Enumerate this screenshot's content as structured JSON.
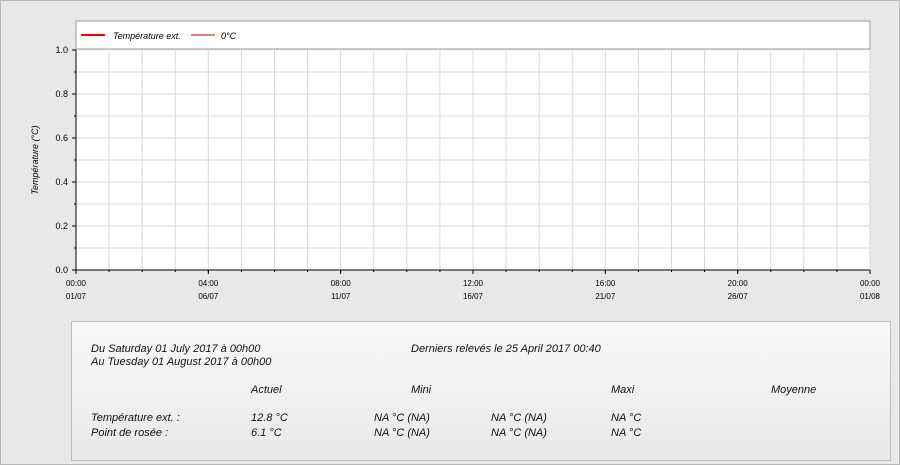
{
  "chart_data": {
    "type": "line",
    "ylabel": "Température (°C)",
    "ylim": [
      0,
      1
    ],
    "yticks": [
      "0.0",
      "0.2",
      "0.4",
      "0.6",
      "0.8",
      "1.0"
    ],
    "x_ticks": [
      {
        "time": "00:00",
        "date": "01/07"
      },
      {
        "time": "04:00",
        "date": "06/07"
      },
      {
        "time": "08:00",
        "date": "11/07"
      },
      {
        "time": "12:00",
        "date": "16/07"
      },
      {
        "time": "16:00",
        "date": "21/07"
      },
      {
        "time": "20:00",
        "date": "26/07"
      },
      {
        "time": "00:00",
        "date": "01/08"
      }
    ],
    "grid": true,
    "legend_position": "top-left",
    "series": [
      {
        "name": "Température ext.",
        "color": "#ff0000",
        "values": []
      },
      {
        "name": "0°C",
        "color": "#cc0000",
        "values": []
      }
    ]
  },
  "info": {
    "period_from": "Du Saturday 01 July 2017 à 00h00",
    "period_to": "Au Tuesday 01 August 2017 à 00h00",
    "last_reading": "Derniers relevés le 25 April 2017 00:40",
    "headers": {
      "actuel": "Actuel",
      "mini": "Mini",
      "maxi": "Maxi",
      "moyenne": "Moyenne"
    },
    "rows": [
      {
        "label": "Température ext. :",
        "actuel": "12.8 °C",
        "mini": "NA °C (NA)",
        "mini2": "NA °C (NA)",
        "maxi": "NA °C"
      },
      {
        "label": "Point de rosée :",
        "actuel": "6.1 °C",
        "mini": "NA °C (NA)",
        "mini2": "NA °C (NA)",
        "maxi": "NA °C"
      }
    ]
  }
}
